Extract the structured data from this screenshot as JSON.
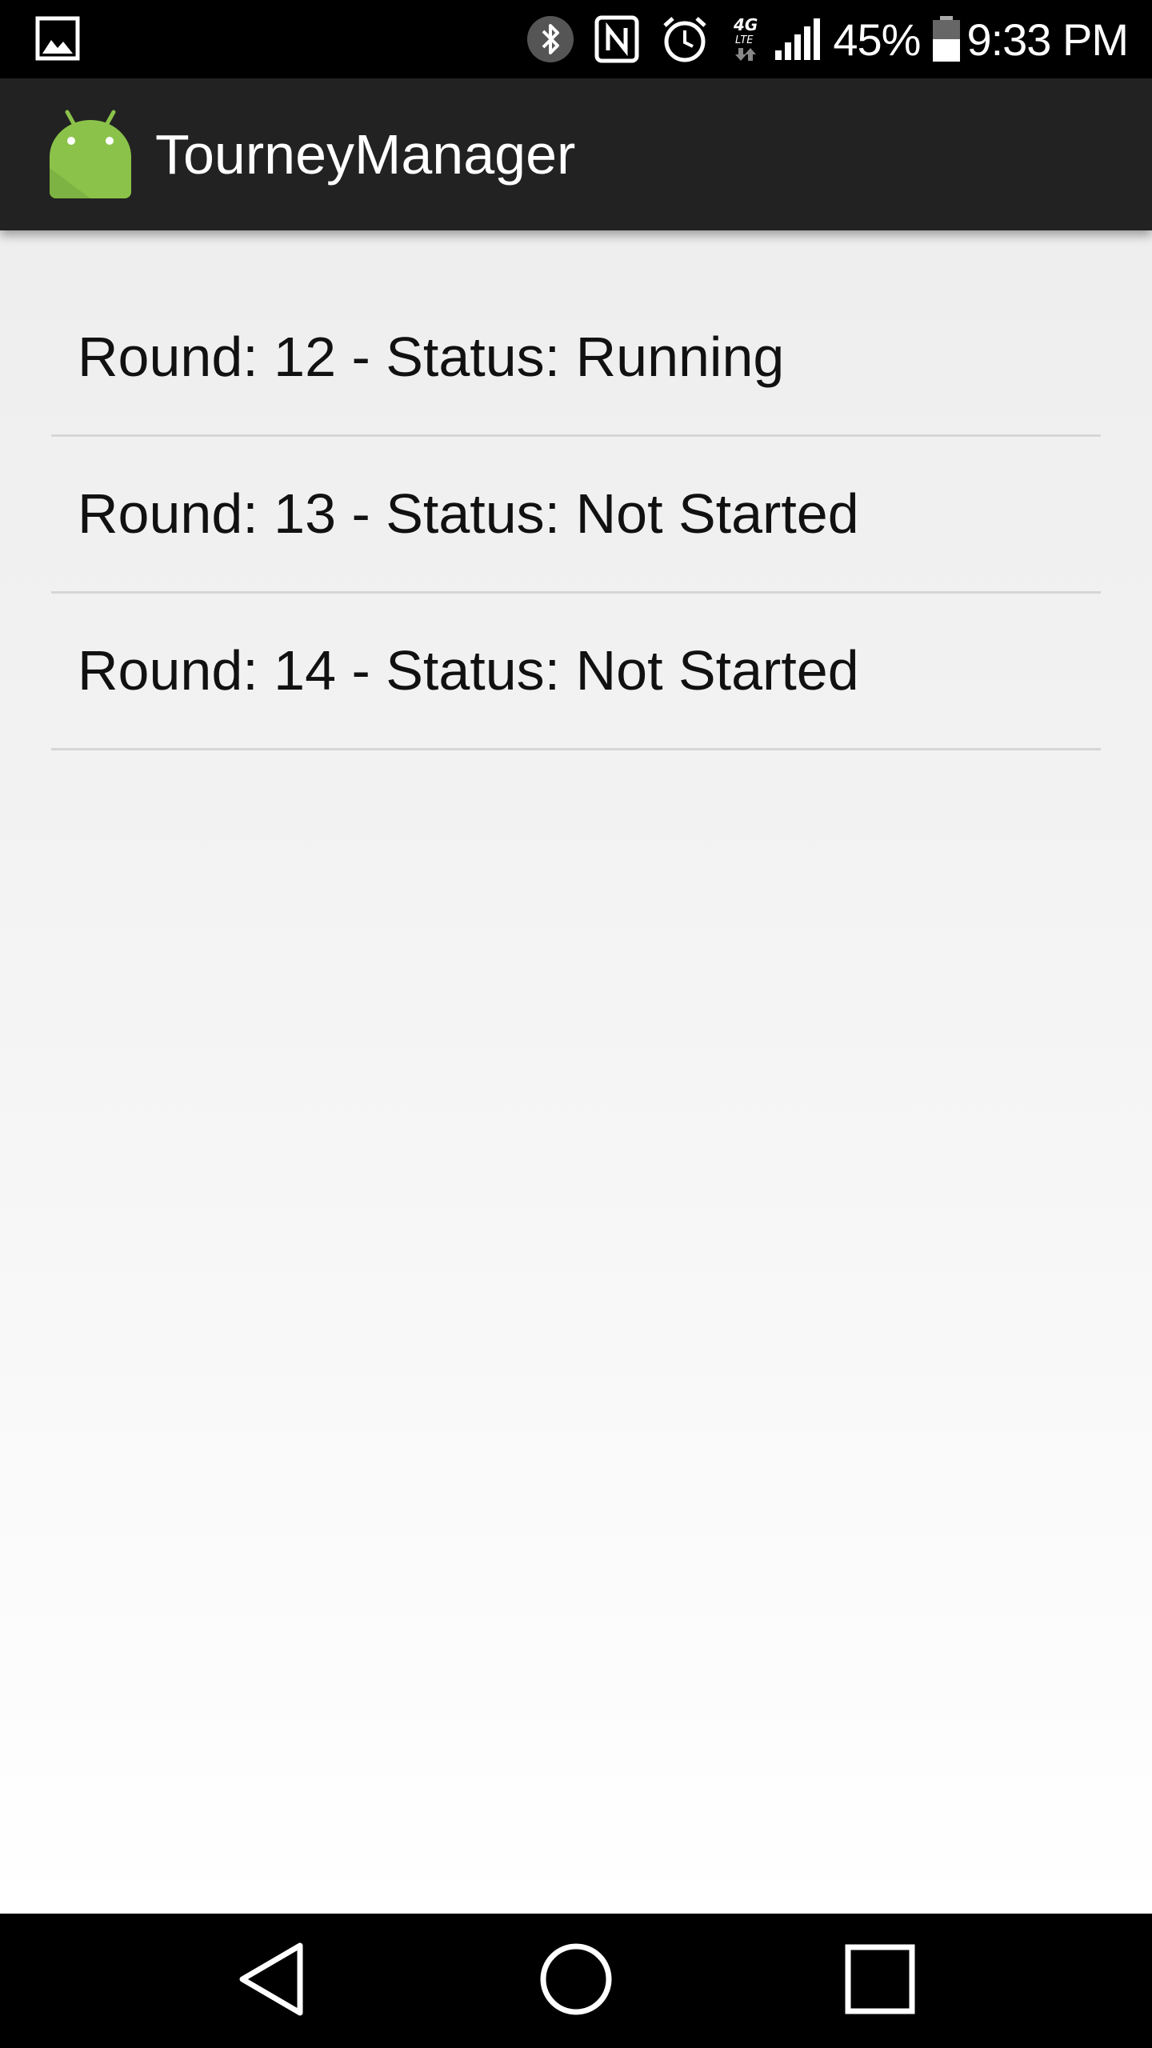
{
  "status_bar": {
    "battery_percent": "45%",
    "time": "9:33 PM",
    "network_type": "4G LTE",
    "icons": [
      "image-notification-icon",
      "bluetooth-icon",
      "nfc-icon",
      "alarm-icon",
      "lte-data-icon",
      "signal-strength-icon",
      "battery-icon"
    ]
  },
  "action_bar": {
    "title": "TourneyManager",
    "logo_icon": "android-robot-icon",
    "background_color": "#222222",
    "logo_color": "#8BC34A"
  },
  "rounds": {
    "items": [
      {
        "label": "Round: 12 - Status: Running"
      },
      {
        "label": "Round: 13 - Status: Not Started"
      },
      {
        "label": "Round: 14 - Status: Not Started"
      }
    ]
  },
  "nav_bar": {
    "buttons": [
      "back-icon",
      "home-icon",
      "recent-apps-icon"
    ]
  }
}
